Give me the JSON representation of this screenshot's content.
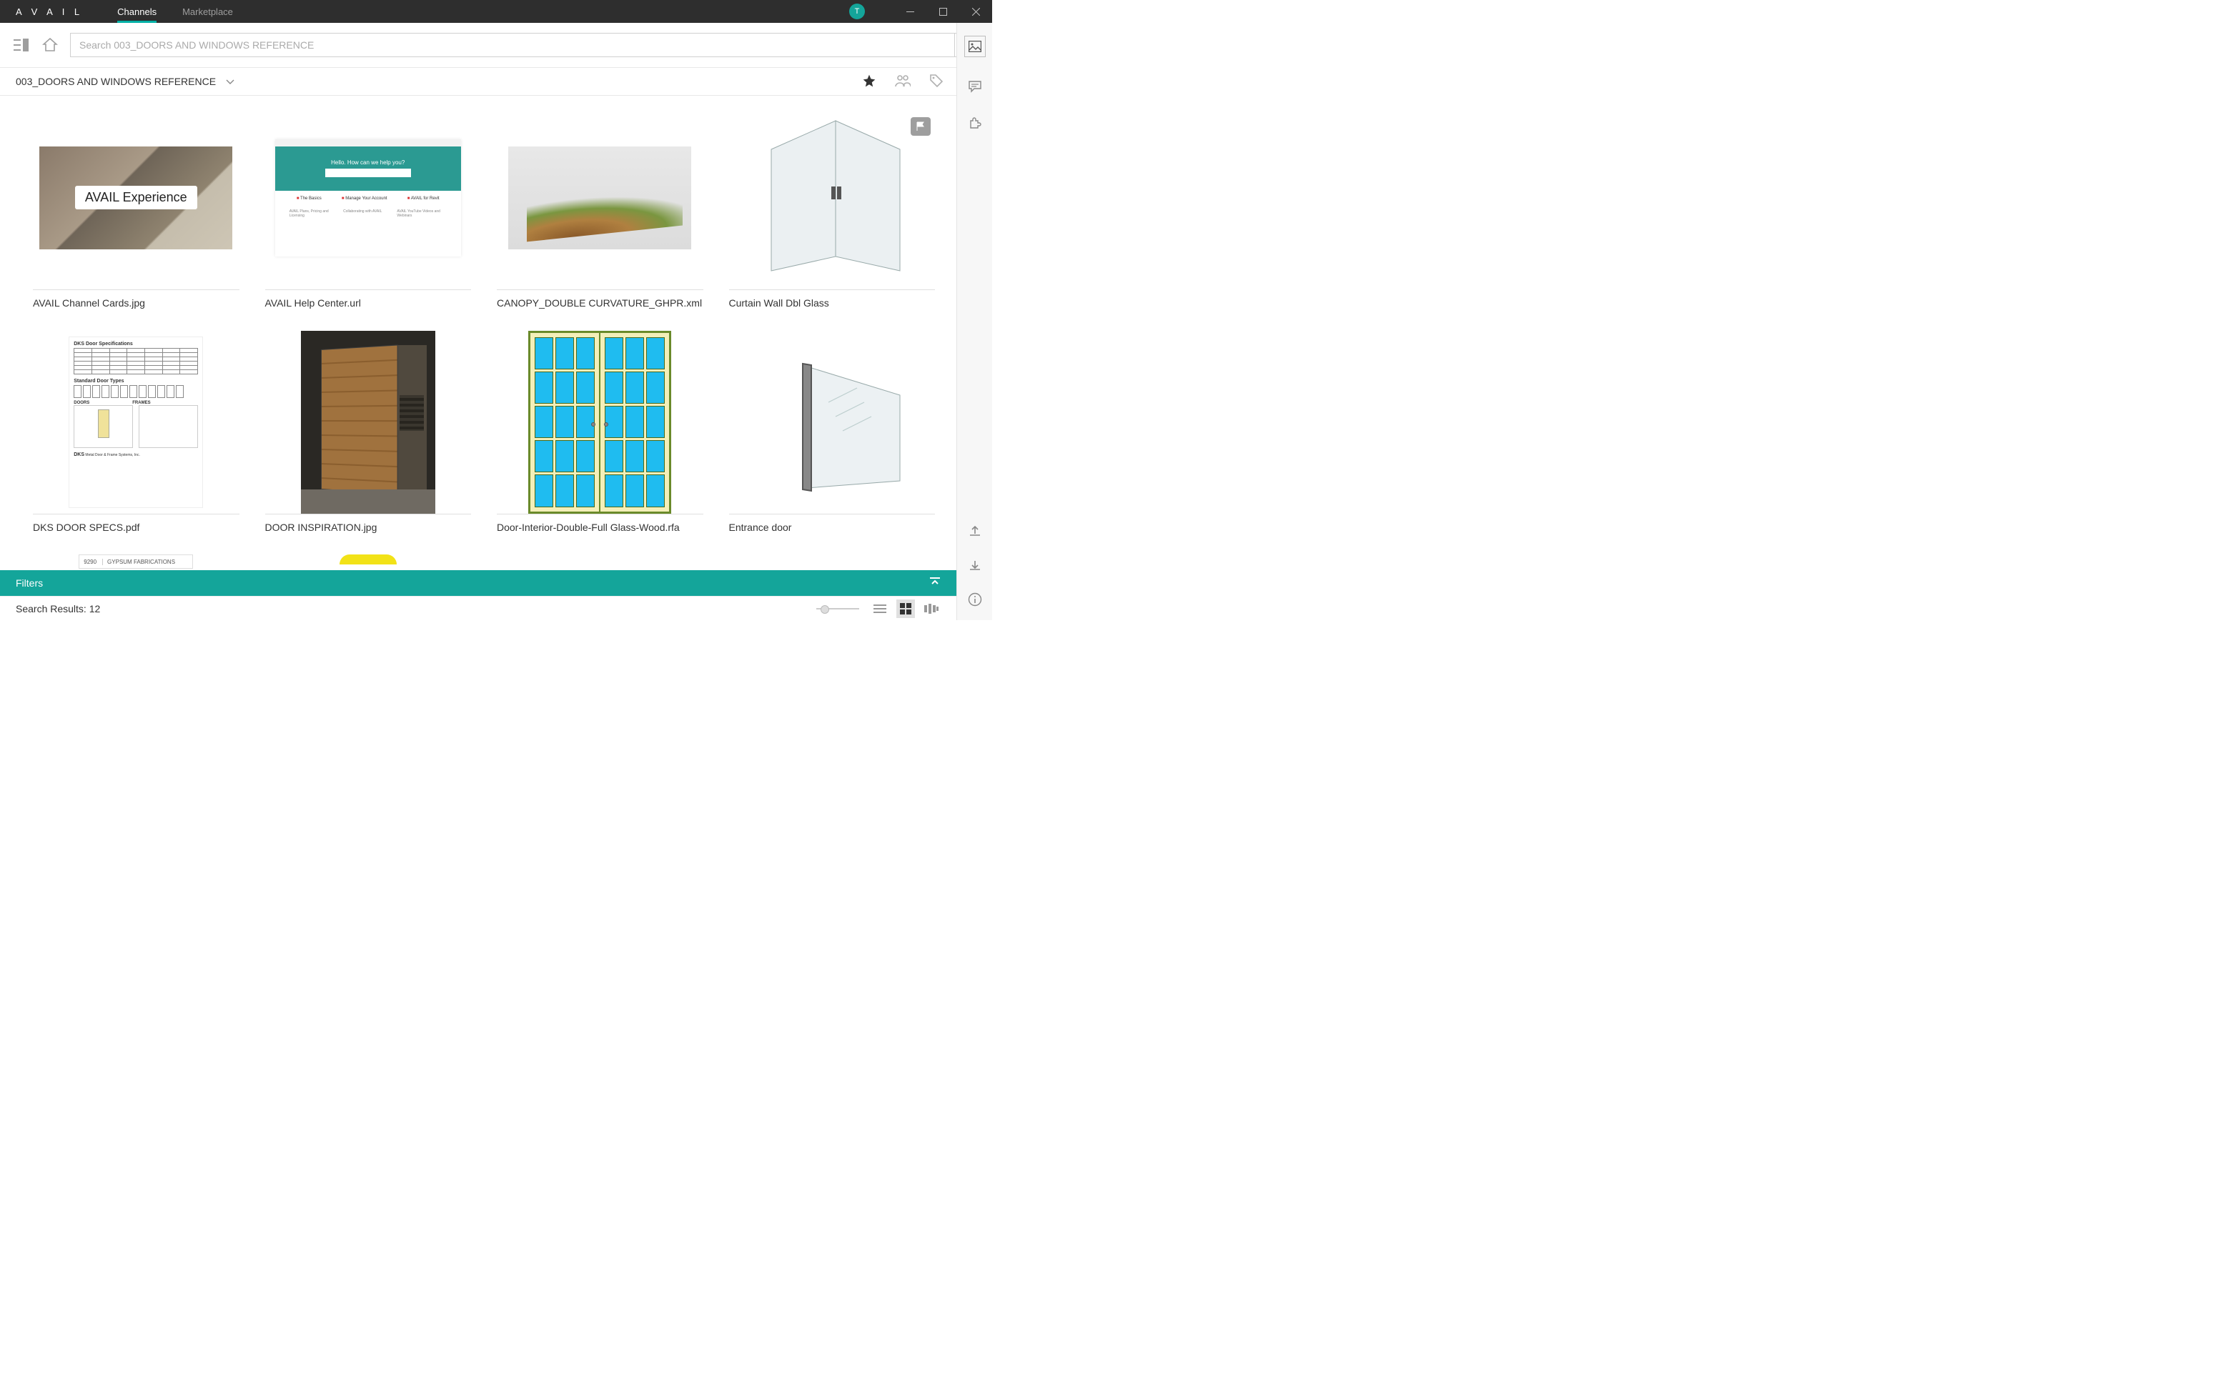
{
  "app": {
    "logo": "A V A I L",
    "tabs": {
      "channels": "Channels",
      "marketplace": "Marketplace"
    },
    "avatar_letter": "T"
  },
  "search": {
    "placeholder": "Search 003_DOORS AND WINDOWS REFERENCE"
  },
  "breadcrumb": {
    "title": "003_DOORS AND WINDOWS REFERENCE"
  },
  "thumbs": {
    "t1_label": "AVAIL Experience",
    "t2_hero": "Hello. How can we help you?",
    "t2_links": [
      "The Basics",
      "Manage Your Account",
      "AVAIL for Revit"
    ],
    "t2_sub": [
      "AVAIL Plans, Pricing and Licensing",
      "Collaborating with AVAIL",
      "AVAIL YouTube Videos and Webinars"
    ],
    "t5_title": "DKS Door Specifications",
    "t5_sub": "Standard Door Types",
    "t5_sec1": "DOORS",
    "t5_sec2": "FRAMES",
    "t5_brand": "DKS",
    "t9_num": "9290",
    "t9_txt": "GYPSUM FABRICATIONS"
  },
  "cards": [
    {
      "title": "AVAIL Channel Cards.jpg"
    },
    {
      "title": "AVAIL Help Center.url"
    },
    {
      "title": "CANOPY_DOUBLE CURVATURE_GHPR.xml"
    },
    {
      "title": "Curtain Wall Dbl Glass"
    },
    {
      "title": "DKS DOOR SPECS.pdf"
    },
    {
      "title": "DOOR INSPIRATION.jpg"
    },
    {
      "title": "Door-Interior-Double-Full Glass-Wood.rfa"
    },
    {
      "title": "Entrance door"
    }
  ],
  "filters": {
    "label": "Filters"
  },
  "footer": {
    "results_label": "Search Results:",
    "results_count": "12"
  }
}
